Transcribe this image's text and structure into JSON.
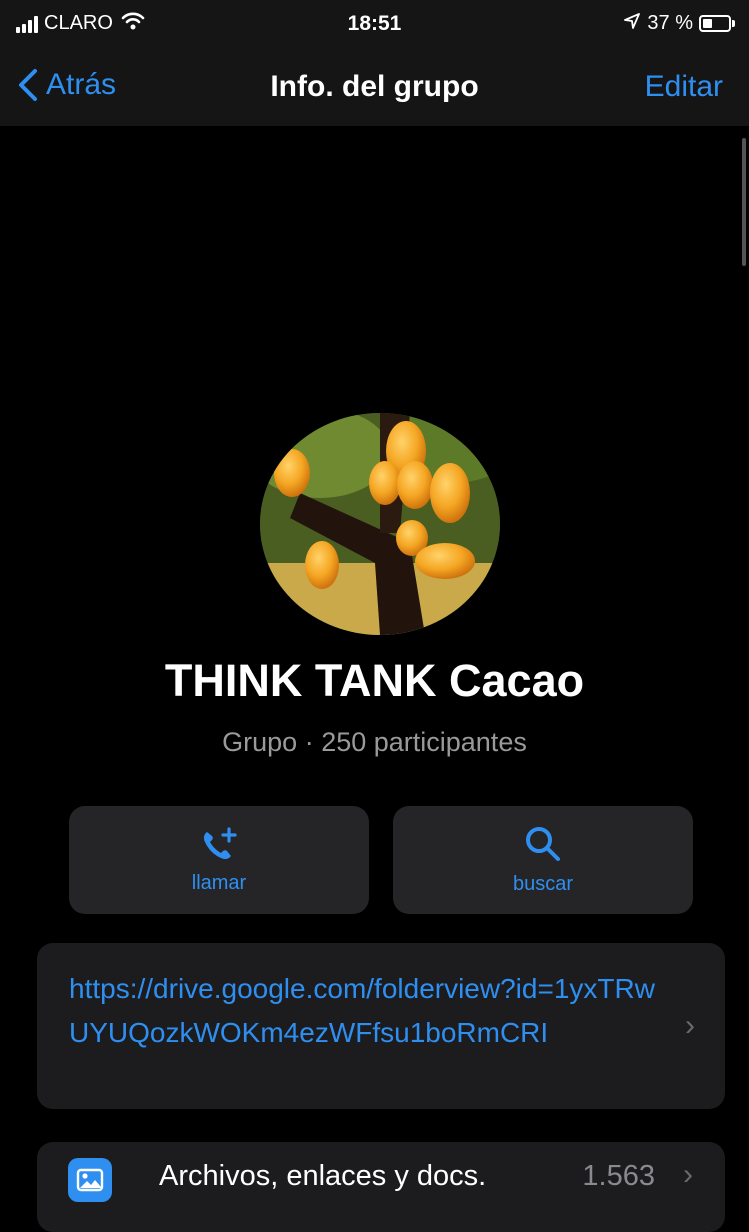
{
  "status_bar": {
    "carrier": "CLARO",
    "time": "18:51",
    "battery_percent": "37 %",
    "battery_level": 0.37
  },
  "nav": {
    "back_label": "Atrás",
    "title": "Info. del grupo",
    "edit_label": "Editar"
  },
  "group": {
    "name": "THINK TANK Cacao",
    "subtitle": "Grupo · 250 participantes"
  },
  "actions": {
    "call_label": "llamar",
    "search_label": "buscar"
  },
  "description_link": "https://drive.google.com/folderview?id=1yxTRwUYUQozkWOKm4ezWFfsu1boRmCRI",
  "files": {
    "label": "Archivos, enlaces y docs.",
    "count": "1.563"
  },
  "colors": {
    "accent": "#2f8ff0",
    "background": "#000000",
    "card": "#1c1c1e",
    "button": "#252527"
  }
}
